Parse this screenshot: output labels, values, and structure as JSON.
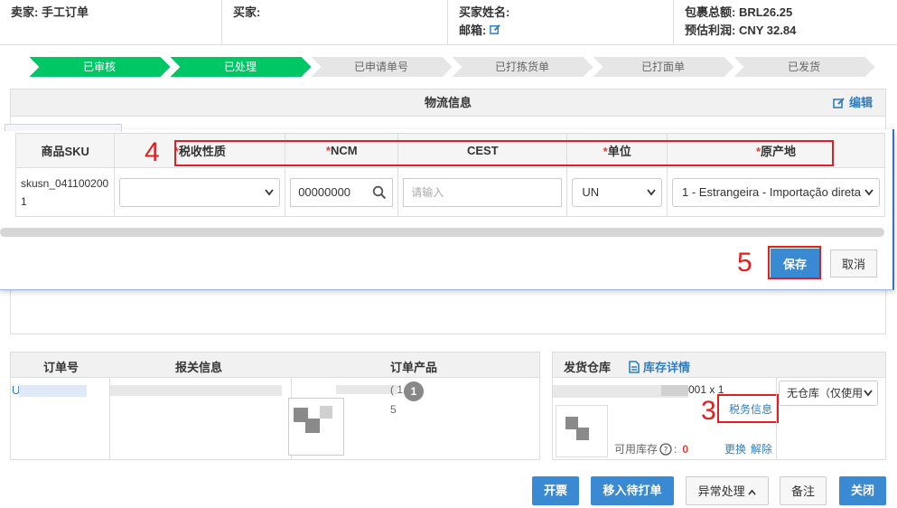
{
  "info": {
    "seller_label": "卖家:",
    "seller_value": "手工订单",
    "buyer_label": "买家:",
    "buyer_name_label": "买家姓名:",
    "email_label": "邮箱:",
    "package_total_label": "包裹总额:",
    "package_total_value": "BRL26.25",
    "est_profit_label": "预估利润:",
    "est_profit_value": "CNY 32.84"
  },
  "steps": [
    {
      "label": "已审核",
      "done": true
    },
    {
      "label": "已处理",
      "done": true
    },
    {
      "label": "已申请单号",
      "done": false
    },
    {
      "label": "已打拣货单",
      "done": false
    },
    {
      "label": "已打面单",
      "done": false
    },
    {
      "label": "已发货",
      "done": false
    }
  ],
  "logistics": {
    "title": "物流信息",
    "edit_label": "编辑"
  },
  "tax_form": {
    "headers": {
      "sku": "商品SKU",
      "tax_nature": "税收性质",
      "ncm": "NCM",
      "cest": "CEST",
      "unit": "单位",
      "origin": "原产地"
    },
    "row": {
      "sku": "skusn_0411002001",
      "tax_nature": "",
      "ncm": "00000000",
      "cest_placeholder": "请输入",
      "unit": "UN",
      "origin": "1 - Estrangeira - Importação direta"
    },
    "save_label": "保存",
    "cancel_label": "取消"
  },
  "annotations": {
    "a3": "3",
    "a4": "4",
    "a5": "5"
  },
  "order": {
    "col_order_no": "订单号",
    "col_customs": "报关信息",
    "col_products": "订单产品",
    "order_prefix": "U",
    "qty": "1",
    "product_code_fragment": "( 1",
    "product_code_fragment2": "5"
  },
  "warehouse": {
    "title": "发货仓库",
    "stock_detail_label": "库存详情",
    "sku_fragment": "001 x 1",
    "tax_info_link": "税务信息",
    "available_stock_label": "可用库存",
    "available_stock_value": "0",
    "replace_label": "更换",
    "remove_label": "解除",
    "warehouse_select": "无仓库（仅使用"
  },
  "buttons": {
    "invoice": "开票",
    "move_to_print": "移入待打单",
    "exception": "异常处理",
    "remark": "备注",
    "close": "关闭"
  },
  "colors": {
    "accent": "#3a8ad3",
    "step_done": "#00c766",
    "annotation": "#e02020"
  }
}
